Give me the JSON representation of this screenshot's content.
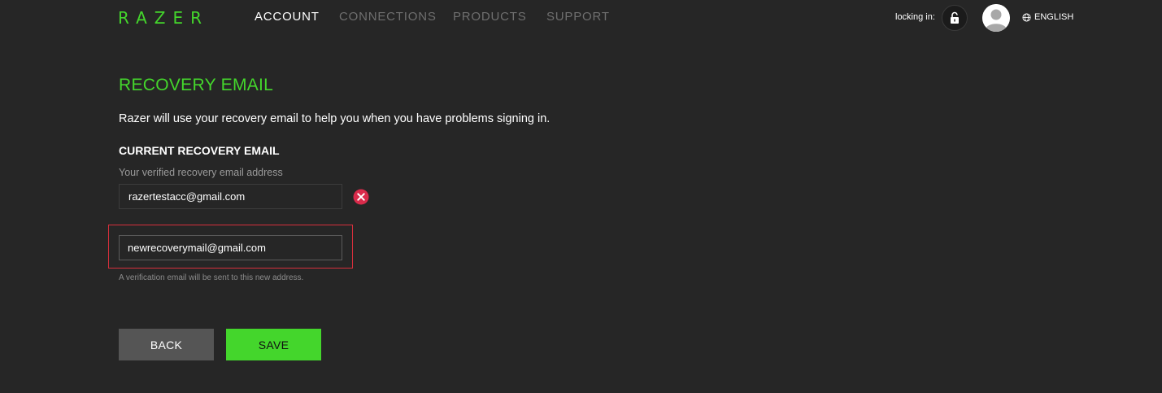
{
  "header": {
    "logo_text": "RAZER",
    "nav": [
      {
        "label": "ACCOUNT",
        "active": true
      },
      {
        "label": "CONNECTIONS",
        "active": false
      },
      {
        "label": "PRODUCTS",
        "active": false
      },
      {
        "label": "SUPPORT",
        "active": false
      }
    ],
    "lock_label": "locking in:",
    "lock_icon": "unlocked-padlock-icon",
    "avatar_icon": "user-avatar-icon",
    "language": "ENGLISH",
    "language_icon": "globe-icon"
  },
  "main": {
    "title": "RECOVERY EMAIL",
    "description": "Razer will use your recovery email to help you when you have problems signing in.",
    "current_heading": "CURRENT RECOVERY EMAIL",
    "current_label": "Your verified recovery email address",
    "current_email": "razertestacc@gmail.com",
    "remove_icon": "remove-circle-x-icon",
    "new_email_value": "newrecoverymail@gmail.com",
    "new_email_placeholder": "",
    "hint": "A verification email will be sent to this new address.",
    "back_label": "BACK",
    "save_label": "SAVE"
  },
  "colors": {
    "accent": "#44d62c",
    "background": "#262626",
    "highlight_border": "#d62f3c",
    "remove_icon": "#d92b4b",
    "back_button": "#555555"
  }
}
